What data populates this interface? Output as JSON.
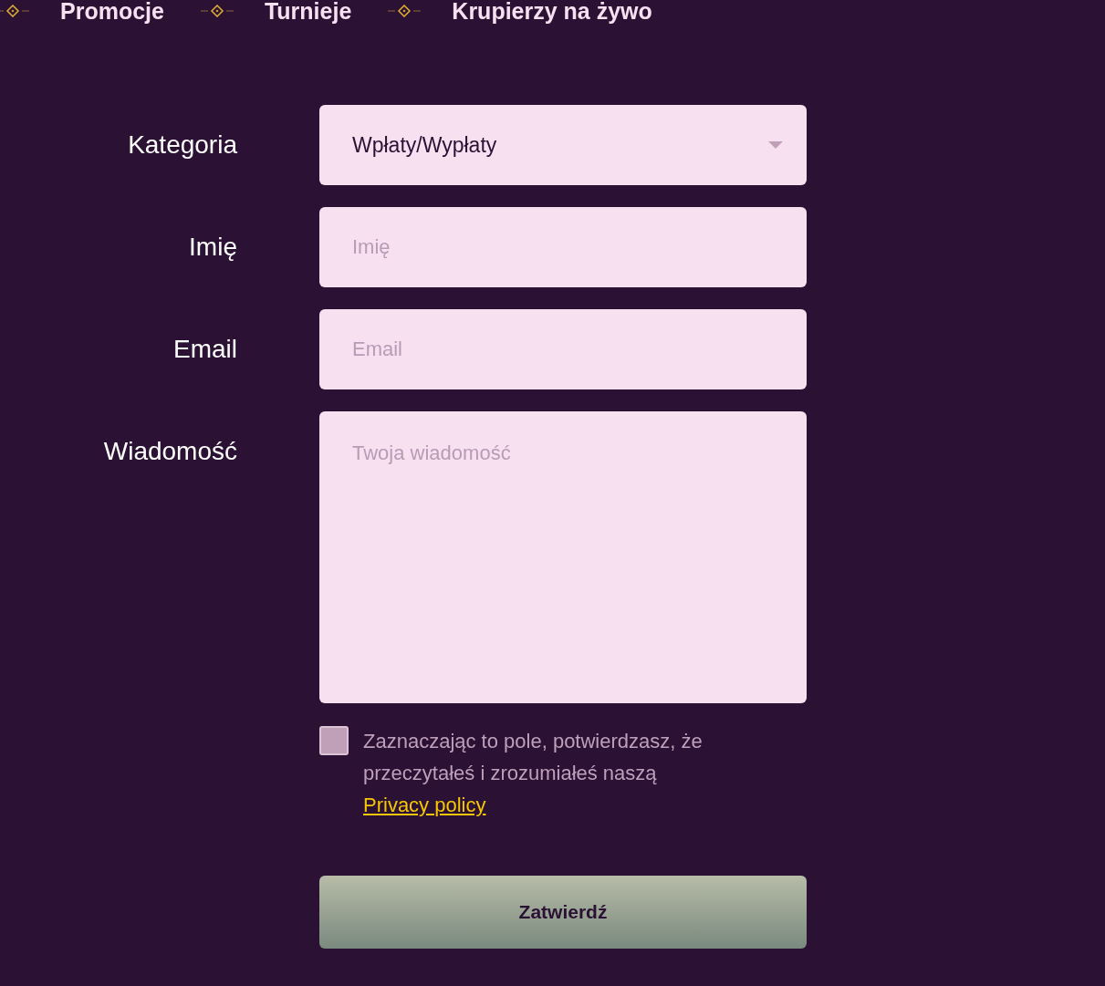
{
  "nav": {
    "items": [
      {
        "label": "Promocje"
      },
      {
        "label": "Turnieje"
      },
      {
        "label": "Krupierzy na żywo"
      }
    ]
  },
  "form": {
    "fields": [
      {
        "kind": "select",
        "label": "Kategoria",
        "value": "Wpłaty/Wypłaty"
      },
      {
        "kind": "input",
        "label": "Imię",
        "placeholder": "Imię"
      },
      {
        "kind": "input",
        "label": "Email",
        "placeholder": "Email"
      },
      {
        "kind": "textarea",
        "label": "Wiadomość",
        "placeholder": "Twoja wiadomość"
      }
    ],
    "consent": {
      "checked": false,
      "text": "Zaznaczając to pole, potwierdzasz, że przeczytałeś i zrozumiałeś naszą",
      "link": "Privacy policy"
    },
    "submit": "Zatwierdź"
  }
}
